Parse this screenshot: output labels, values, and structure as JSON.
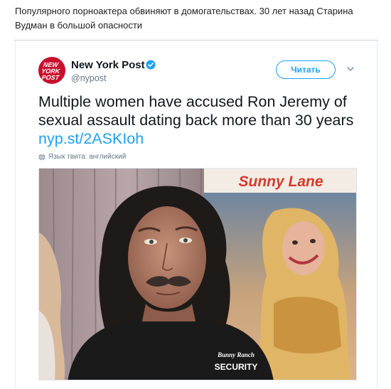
{
  "post": {
    "caption": "Популярного порноактера обвиняют в домогательствах. 30 лет назад Старина Вудман в большой опасности"
  },
  "tweet": {
    "author_name": "New York Post",
    "author_handle": "@nypost",
    "avatar_text": [
      "NEW",
      "YORK",
      "POST"
    ],
    "follow_label": "Читать",
    "text": "Multiple women have accused Ron Jeremy of sexual assault dating back more than 30 years ",
    "link": "nyp.st/2ASKIoh",
    "language_note": "Язык твита: английский"
  },
  "photo": {
    "banner_text": "Sunny Lane",
    "shirt_logo": "Bunny Ranch",
    "shirt_text": "SECURITY"
  },
  "colors": {
    "twitter_blue": "#1da1f2",
    "nypost_red": "#c8102e",
    "muted": "#657786"
  }
}
